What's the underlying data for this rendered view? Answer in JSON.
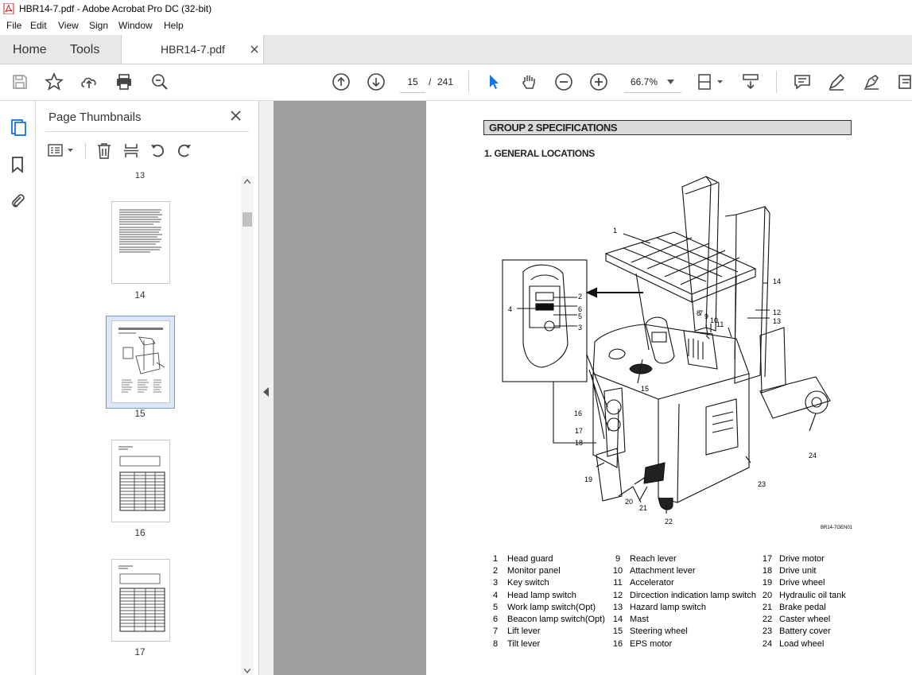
{
  "window": {
    "title": "HBR14-7.pdf - Adobe Acrobat Pro DC (32-bit)"
  },
  "menu": [
    "File",
    "Edit",
    "View",
    "Sign",
    "Window",
    "Help"
  ],
  "tabs": {
    "home": "Home",
    "tools": "Tools",
    "document": "HBR14-7.pdf"
  },
  "toolbar": {
    "page_current": "15",
    "page_separator": "/",
    "page_total": "241",
    "zoom": "66.7%"
  },
  "thumbnails": {
    "title": "Page Thumbnails",
    "top_partial_label": "13",
    "pages": [
      {
        "label": "14",
        "selected": false
      },
      {
        "label": "15",
        "selected": true
      },
      {
        "label": "16",
        "selected": false
      },
      {
        "label": "17",
        "selected": false
      }
    ]
  },
  "document": {
    "section_header": "GROUP 2  SPECIFICATIONS",
    "subheading": "1. GENERAL LOCATIONS",
    "figure_code": "BR14-7GEN01",
    "callouts": [
      "1",
      "2",
      "3",
      "4",
      "5",
      "6",
      "7",
      "8",
      "9",
      "10",
      "11",
      "12",
      "13",
      "14",
      "15",
      "16",
      "17",
      "18",
      "19",
      "20",
      "21",
      "22",
      "23",
      "24"
    ],
    "legend": [
      {
        "num": "1",
        "text": "Head guard"
      },
      {
        "num": "2",
        "text": "Monitor panel"
      },
      {
        "num": "3",
        "text": "Key switch"
      },
      {
        "num": "4",
        "text": "Head lamp switch"
      },
      {
        "num": "5",
        "text": "Work lamp switch(Opt)"
      },
      {
        "num": "6",
        "text": "Beacon lamp switch(Opt)"
      },
      {
        "num": "7",
        "text": "Lift lever"
      },
      {
        "num": "8",
        "text": "Tilt lever"
      },
      {
        "num": "9",
        "text": "Reach lever"
      },
      {
        "num": "10",
        "text": "Attachment lever"
      },
      {
        "num": "11",
        "text": "Accelerator"
      },
      {
        "num": "12",
        "text": "Dircection indication lamp switch"
      },
      {
        "num": "13",
        "text": "Hazard lamp switch"
      },
      {
        "num": "14",
        "text": "Mast"
      },
      {
        "num": "15",
        "text": "Steering wheel"
      },
      {
        "num": "16",
        "text": "EPS motor"
      },
      {
        "num": "17",
        "text": "Drive motor"
      },
      {
        "num": "18",
        "text": "Drive unit"
      },
      {
        "num": "19",
        "text": "Drive wheel"
      },
      {
        "num": "20",
        "text": "Hydraulic oil tank"
      },
      {
        "num": "21",
        "text": "Brake pedal"
      },
      {
        "num": "22",
        "text": "Caster wheel"
      },
      {
        "num": "23",
        "text": "Battery cover"
      },
      {
        "num": "24",
        "text": "Load wheel"
      }
    ]
  },
  "colors": {
    "acrobat_red": "#d7191c",
    "tool_blue": "#1473e6",
    "doc_background": "#9e9e9e",
    "header_bar": "#d9d9d9"
  }
}
